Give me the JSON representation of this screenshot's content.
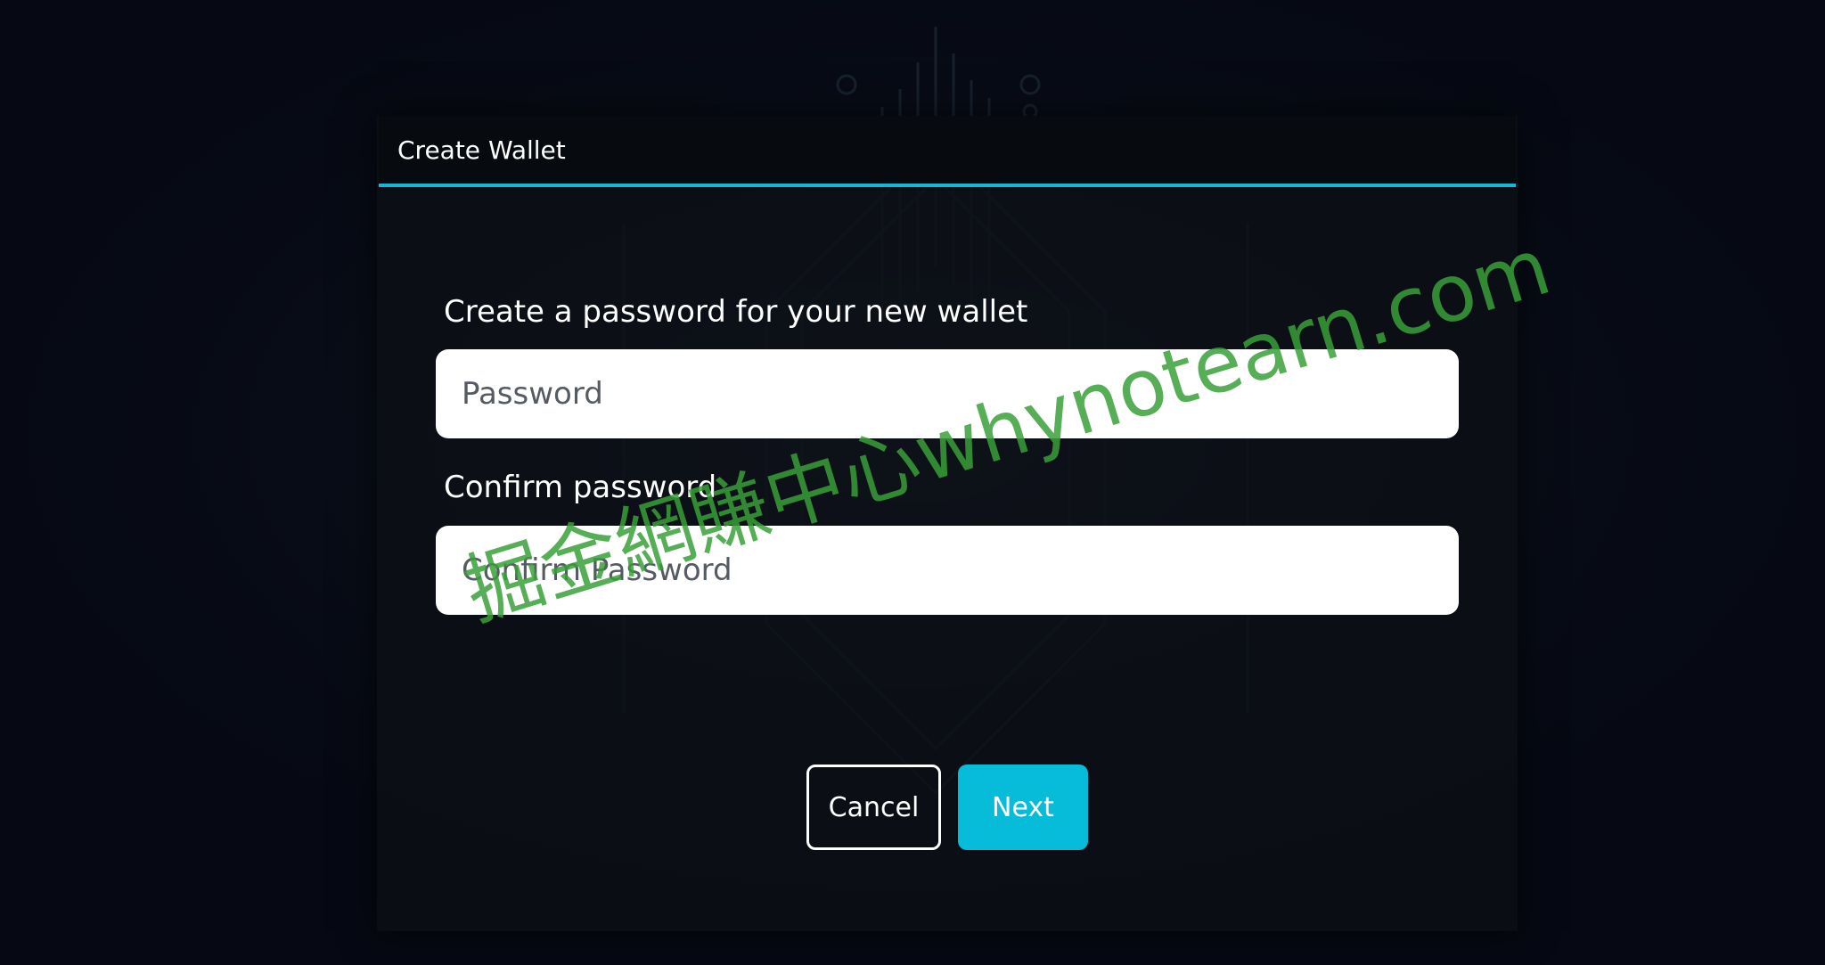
{
  "dialog": {
    "title": "Create Wallet"
  },
  "form": {
    "password_label": "Create a password for your new wallet",
    "password_placeholder": "Password",
    "confirm_label": "Confirm password",
    "confirm_placeholder": "Confirm Password"
  },
  "actions": {
    "cancel_label": "Cancel",
    "next_label": "Next"
  },
  "watermark": {
    "text": "掘金網賺中心whynotearn.com"
  },
  "colors": {
    "accent": "#19b6cf",
    "next_button": "#06bcd8",
    "background": "#060913",
    "watermark": "#38a038"
  }
}
